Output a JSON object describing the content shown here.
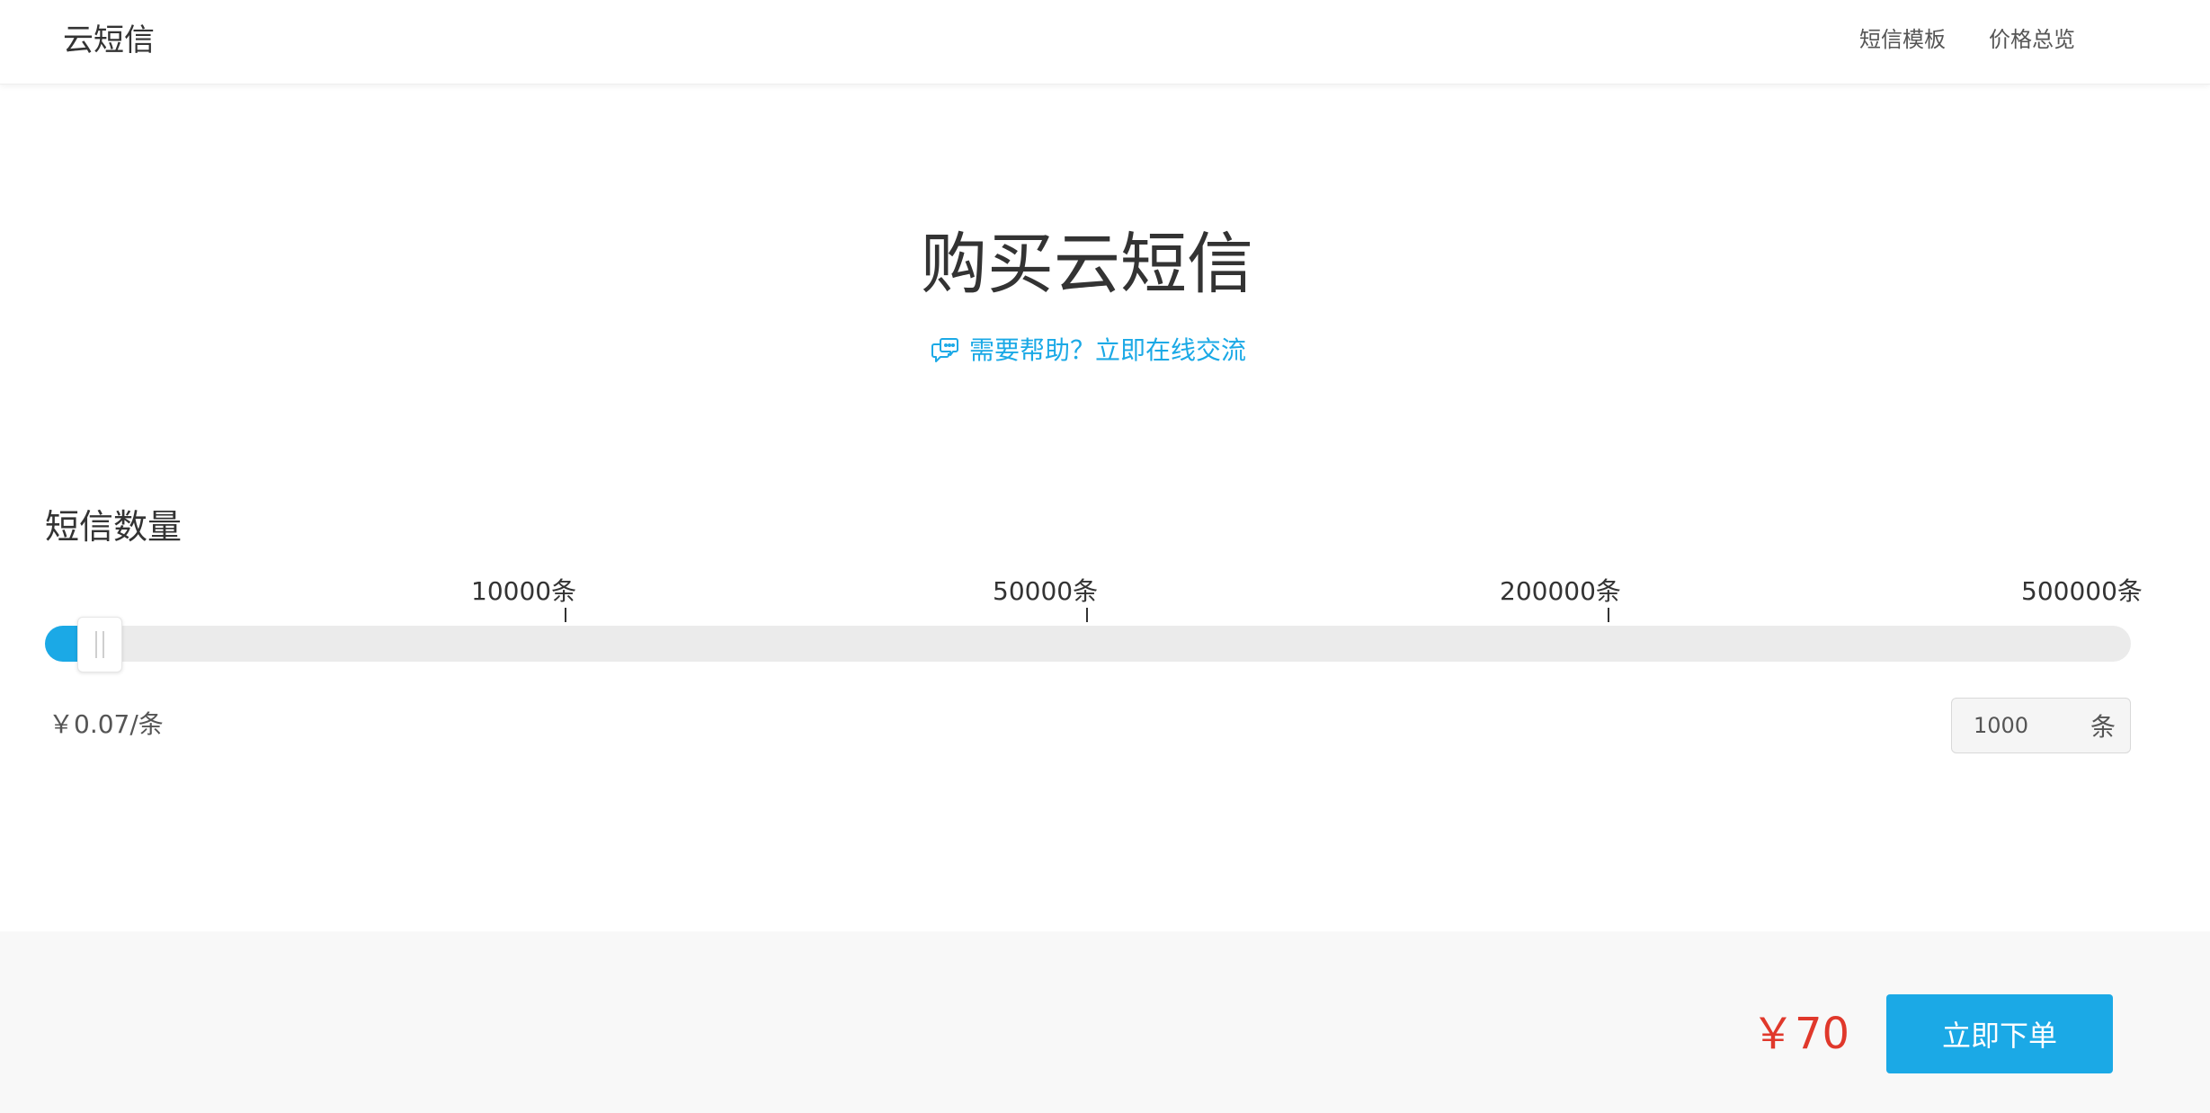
{
  "header": {
    "brand": "云短信",
    "nav": [
      {
        "label": "短信模板"
      },
      {
        "label": "价格总览"
      }
    ]
  },
  "hero": {
    "title": "购买云短信",
    "help_text": "需要帮助？立即在线交流",
    "help_icon": "chat-bubbles-icon"
  },
  "quantity": {
    "label": "短信数量",
    "ticks": [
      "10000条",
      "50000条",
      "200000条",
      "500000条"
    ],
    "slider_level": 0.016,
    "unit_price": "￥0.07/条",
    "input_value": "1000",
    "input_unit": "条"
  },
  "order": {
    "total": "￥70",
    "button_label": "立即下单"
  },
  "colors": {
    "accent": "#1ba9e6",
    "price": "#e0382b",
    "track": "#ebebeb"
  }
}
